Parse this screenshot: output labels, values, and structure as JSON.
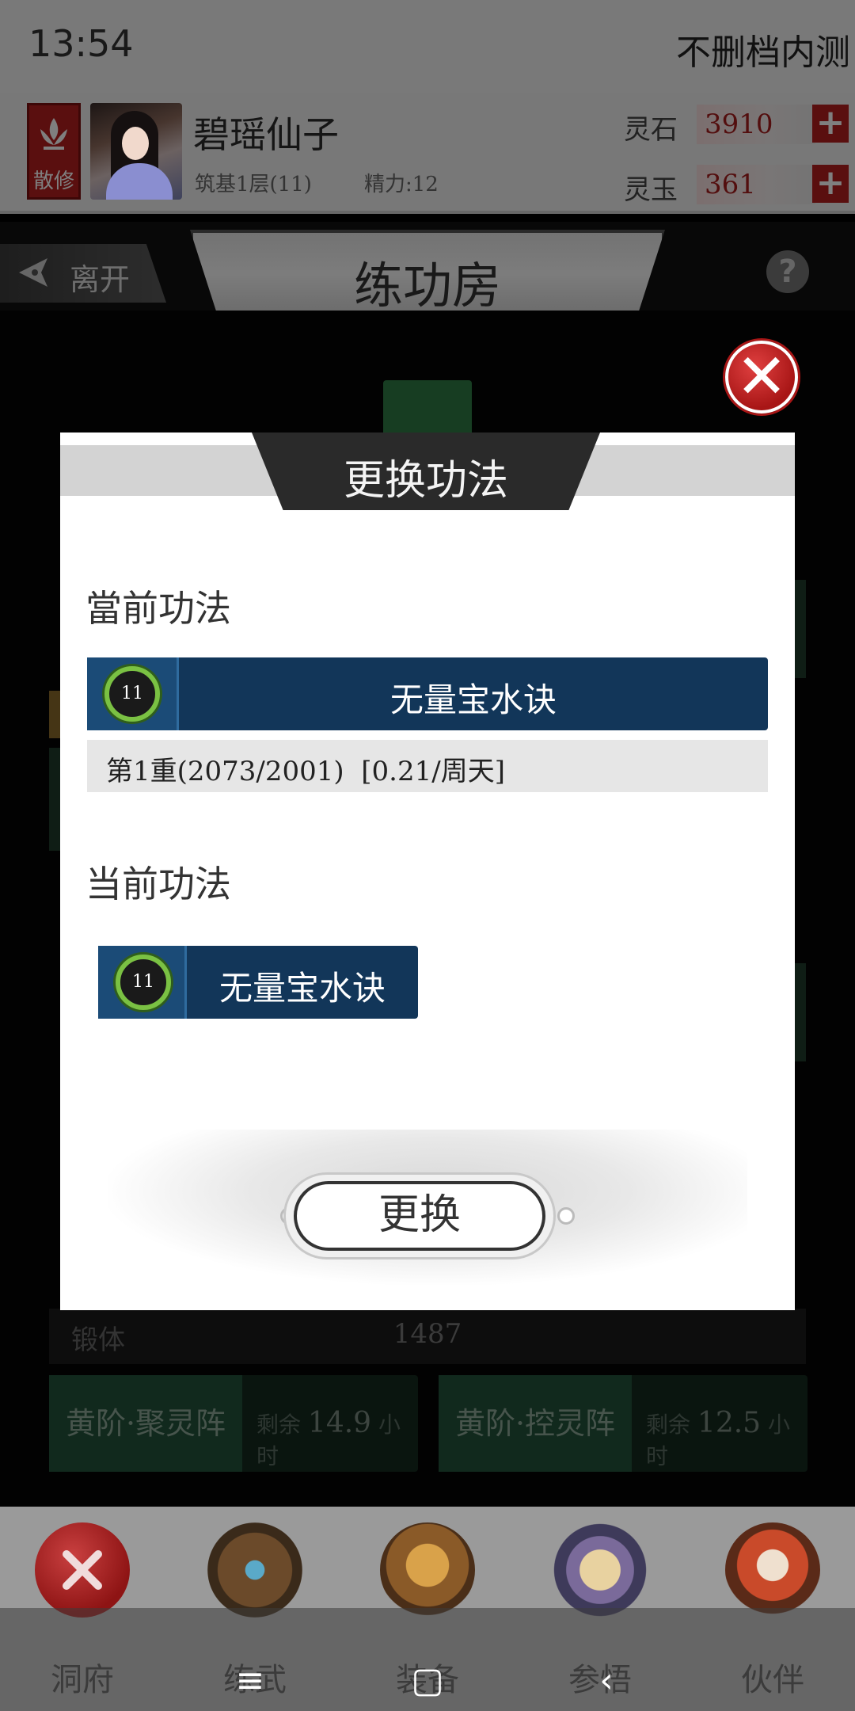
{
  "status": {
    "time": "13:54",
    "server_label": "不删档内测"
  },
  "player": {
    "sect": "散修",
    "name": "碧瑶仙子",
    "level": "筑基1层(11)",
    "energy": "精力:12",
    "currencies": [
      {
        "label": "灵石",
        "value": "3910"
      },
      {
        "label": "灵玉",
        "value": "361"
      }
    ],
    "plus_glyph": "+"
  },
  "titlebar": {
    "leave_label": "离开",
    "title": "练功房",
    "help_glyph": "?"
  },
  "background": {
    "forge": {
      "label": "锻体",
      "value": "1487"
    },
    "arrays": [
      {
        "name": "黄阶·聚灵阵",
        "remain_prefix": "剩余",
        "remain_value": "14.9",
        "remain_unit": "小时"
      },
      {
        "name": "黄阶·控灵阵",
        "remain_prefix": "剩余",
        "remain_value": "12.5",
        "remain_unit": "小时"
      }
    ]
  },
  "modal": {
    "title": "更换功法",
    "current_label": "當前功法",
    "current_skill": {
      "level": "11",
      "name": "无量宝水诀"
    },
    "progress_text": "第1重(2073/2001)  [0.21/周天]",
    "list_label": "当前功法",
    "list_skill": {
      "level": "11",
      "name": "无量宝水诀"
    },
    "swap_button": "更换",
    "close_glyph": "✕"
  },
  "bottom_nav": [
    {
      "label": "洞府"
    },
    {
      "label": "练武"
    },
    {
      "label": "装备"
    },
    {
      "label": "参悟"
    },
    {
      "label": "伙伴"
    }
  ],
  "system_nav": {
    "menu": "≡",
    "home": "▢",
    "back": "‹"
  }
}
